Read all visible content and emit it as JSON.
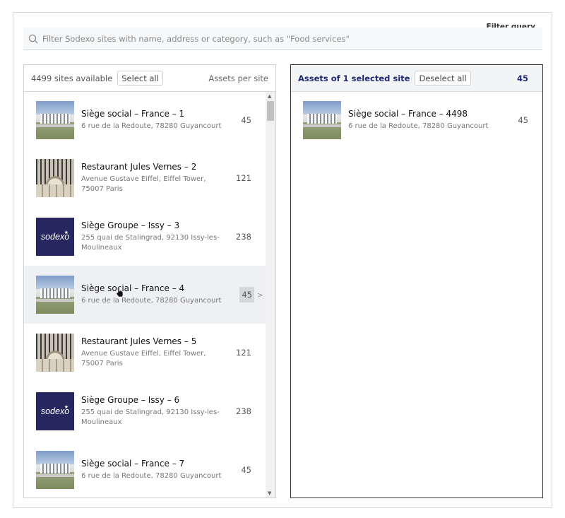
{
  "header": {
    "filter_label": "Filter query",
    "search_placeholder": "Filter Sodexo sites with name, address or category, such as \"Food services\""
  },
  "left_panel": {
    "count_text": "4499 sites available",
    "select_all_label": "Select all",
    "assets_header": "Assets per site",
    "sites": [
      {
        "name": "Siège social – France – 1",
        "address": "6 rue de la Redoute, 78280 Guyancourt",
        "assets": "45",
        "image": "building"
      },
      {
        "name": "Restaurant Jules Vernes – 2",
        "address": "Avenue Gustave Eiffel, Eiffel Tower, 75007 Paris",
        "assets": "121",
        "image": "restaurant"
      },
      {
        "name": "Siège Groupe – Issy – 3",
        "address": "255 quai de Stalingrad, 92130 Issy-les-Moulineaux",
        "assets": "238",
        "image": "logo"
      },
      {
        "name": "Siège social – France – 4",
        "address": "6 rue de la Redoute, 78280 Guyancourt",
        "assets": "45",
        "image": "building"
      },
      {
        "name": "Restaurant Jules Vernes – 5",
        "address": "Avenue Gustave Eiffel, Eiffel Tower, 75007 Paris",
        "assets": "121",
        "image": "restaurant"
      },
      {
        "name": "Siège Groupe – Issy – 6",
        "address": "255 quai de Stalingrad, 92130 Issy-les-Moulineaux",
        "assets": "238",
        "image": "logo"
      },
      {
        "name": "Siège social – France – 7",
        "address": "6 rue de la Redoute, 78280 Guyancourt",
        "assets": "45",
        "image": "building"
      }
    ],
    "hover_arrow": ">"
  },
  "right_panel": {
    "title": "Assets of 1 selected site",
    "deselect_all_label": "Deselect all",
    "total_assets": "45",
    "sites": [
      {
        "name": "Siège social – France – 4498",
        "address": "6 rue de la Redoute, 78280 Guyancourt",
        "assets": "45",
        "image": "building"
      }
    ]
  },
  "logo_text": "sodexo",
  "colors": {
    "accent": "#1f2a7a",
    "logo_bg": "#27275f",
    "hover_bg": "#eef0f4"
  },
  "icons": {
    "search": "search-icon",
    "cursor": "hand-cursor-icon"
  }
}
